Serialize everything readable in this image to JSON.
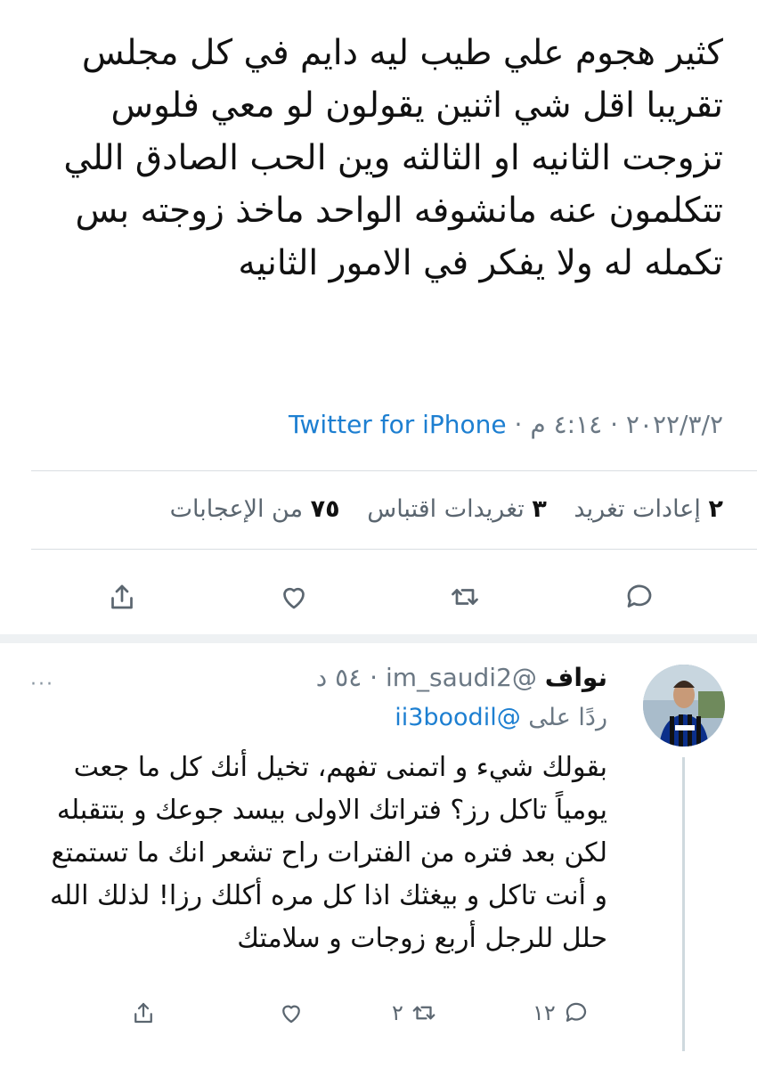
{
  "tweet": {
    "text": "كثير هجوم علي طيب ليه دايم في كل مجلس تقريبا اقل شي اثنين يقولون لو معي فلوس تزوجت الثانيه او الثالثه وين الحب الصادق اللي تتكلمون عنه مانشوفه الواحد ماخذ زوجته بس تكمله له ولا يفكر في الامور الثانيه",
    "date": "٢٠٢٢/٣/٢",
    "time": "٤:١٤ م",
    "separator": "·",
    "source": "Twitter for iPhone"
  },
  "stats": {
    "retweets_count": "٢",
    "retweets_label": "إعادات تغريد",
    "quotes_count": "٣",
    "quotes_label": "تغريدات اقتباس",
    "likes_count": "٧٥",
    "likes_label": "من الإعجابات"
  },
  "actions": [
    "reply-icon",
    "retweet-icon",
    "like-icon",
    "share-icon"
  ],
  "reply": {
    "name": "نواف",
    "handle": "@im_saudi2",
    "separator": "·",
    "time": "٥٤ د",
    "replying_label": "ردًا على",
    "replying_to": "@ii3boodil",
    "text": "بقولك شيء و اتمنى تفهم، تخيل أنك كل ما جعت يومياً تاكل رز؟ فتراتك الاولى بيسد جوعك و بتتقبله لكن بعد فتره من الفترات راح تشعر انك ما تستمتع و أنت تاكل و بيغثك اذا كل مره أكلك رزا! لذلك الله حلل للرجل أربع زوجات و سلامتك",
    "reply_count": "١٢",
    "retweet_count": "٢",
    "more_label": "···"
  },
  "colors": {
    "link": "#1d7fd1",
    "muted": "#6b7884",
    "divider": "#d9dee2"
  }
}
